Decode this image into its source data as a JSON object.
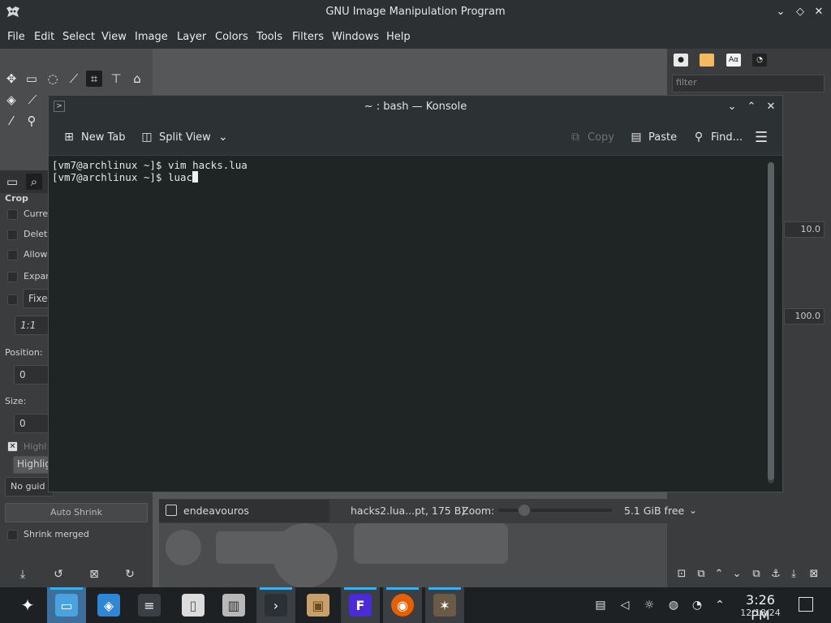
{
  "gimp": {
    "title": "GNU Image Manipulation Program",
    "menus": [
      "File",
      "Edit",
      "Select",
      "View",
      "Image",
      "Layer",
      "Colors",
      "Tools",
      "Filters",
      "Windows",
      "Help"
    ],
    "tool_options": {
      "section": "Crop",
      "options": [
        "Curre",
        "Delete",
        "Allow",
        "Expan",
        "Fixed"
      ],
      "ratio": "1:1",
      "position_label": "Position:",
      "position_value": "0",
      "size_label": "Size:",
      "size_value": "0",
      "highlight_label": "Highl",
      "highlight_combo": "Highlig",
      "guides_combo": "No guid",
      "auto_shrink": "Auto Shrink",
      "shrink_merged": "Shrink merged"
    },
    "right_panel": {
      "filter_placeholder": "filter",
      "spin1": "10.0",
      "spin2": "100.0"
    },
    "statusbar": {
      "file_info": "hacks2.lua...pt, 175 B)",
      "zoom_label": "Zoom:",
      "memory": "5.1 GiB free",
      "bottom_item": "endeavouros"
    }
  },
  "konsole": {
    "title": "~ : bash — Konsole",
    "toolbar": {
      "new_tab": "New Tab",
      "split_view": "Split View",
      "copy": "Copy",
      "paste": "Paste",
      "find": "Find..."
    },
    "terminal_lines": [
      "[vm7@archlinux ~]$ vim hacks.lua",
      "[vm7@archlinux ~]$ luac"
    ]
  },
  "taskbar": {
    "time": "3:26 PM",
    "date": "12/18/24"
  },
  "colors": {
    "accent": "#3daee9",
    "active_task": "#3d6f9a",
    "terminal_bg": "#1f2424"
  }
}
